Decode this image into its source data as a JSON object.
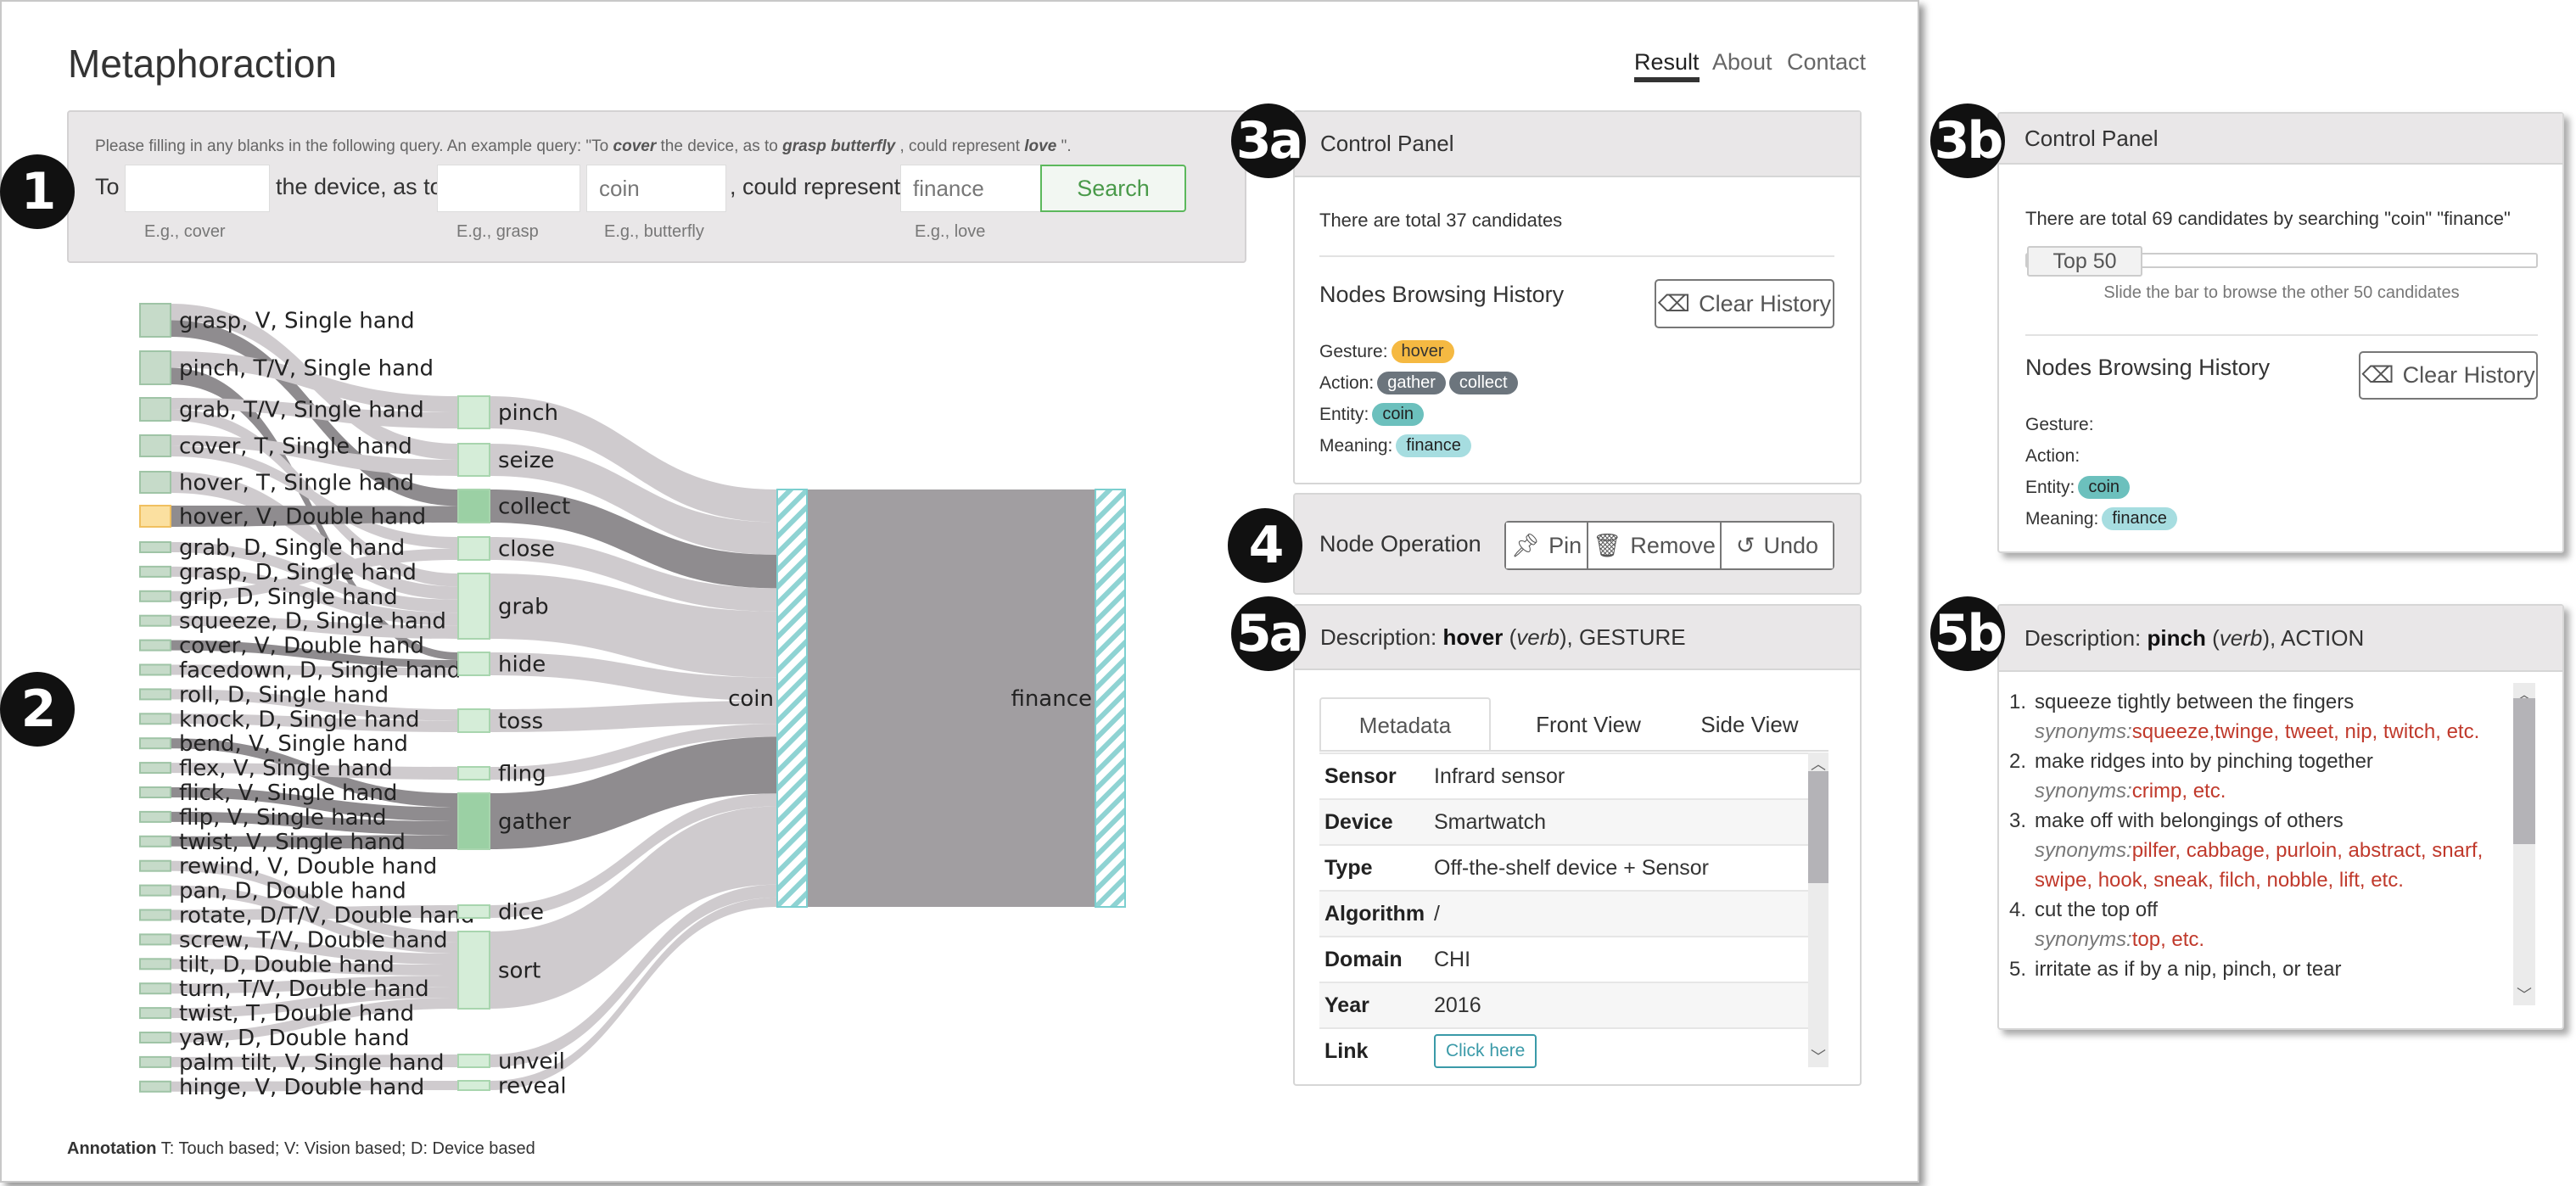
{
  "app": {
    "title": "Metaphoraction",
    "nav": [
      "Result",
      "About",
      "Contact"
    ],
    "active_nav": "Result"
  },
  "badges": {
    "query": "1",
    "sankey": "2",
    "control_a": "3a",
    "control_b": "3b",
    "node_op": "4",
    "desc_a": "5a",
    "desc_b": "5b"
  },
  "query": {
    "hint": [
      {
        "t": "Please filling in any blanks in the following query. An example query: \"To ",
        "i": false
      },
      {
        "t": "cover",
        "i": true
      },
      {
        "t": " the device, as to ",
        "i": false
      },
      {
        "t": "grasp butterfly",
        "i": true
      },
      {
        "t": " , could represent ",
        "i": false
      },
      {
        "t": "love",
        "i": true
      },
      {
        "t": " \".",
        "i": false
      }
    ],
    "to": "To",
    "the_device": "the device, as to",
    "could_represent": ", could represent",
    "gesture": {
      "value": "",
      "hint": "E.g., cover"
    },
    "action": {
      "value": "",
      "hint": "E.g., grasp"
    },
    "entity": {
      "value": "coin",
      "hint": "E.g., butterfly"
    },
    "meaning": {
      "value": "finance",
      "hint": "E.g., love"
    },
    "search_label": "Search"
  },
  "sankey": {
    "left_nodes": [
      "grasp, V, Single hand",
      "pinch, T/V, Single hand",
      "grab, T/V, Single hand",
      "cover, T, Single hand",
      "hover, T, Single hand",
      "hover, V, Double hand",
      "grab, D, Single hand",
      "grasp, D, Single hand",
      "grip, D, Single hand",
      "squeeze, D, Single hand",
      "cover, V, Double hand",
      "facedown, D, Single hand",
      "roll, D, Single hand",
      "knock, D, Single hand",
      "bend, V, Single hand",
      "flex, V, Single hand",
      "flick, V, Single hand",
      "flip, V, Single hand",
      "twist, V, Single hand",
      "rewind, V, Double hand",
      "pan, D, Double hand",
      "rotate, D/T/V, Double hand",
      "screw, T/V, Double hand",
      "tilt, D, Double hand",
      "turn, T/V, Double hand",
      "twist, T, Double hand",
      "yaw, D, Double hand",
      "palm tilt, V, Single hand",
      "hinge, V, Double hand"
    ],
    "selected_gesture": "hover, V, Double hand",
    "mid_nodes": [
      "pinch",
      "seize",
      "collect",
      "close",
      "grab",
      "hide",
      "toss",
      "fling",
      "gather",
      "dice",
      "sort",
      "unveil",
      "reveal"
    ],
    "highlighted_actions": [
      "collect",
      "gather"
    ],
    "entity": "coin",
    "meaning": "finance",
    "links": [
      [
        0,
        1,
        false
      ],
      [
        0,
        2,
        true
      ],
      [
        1,
        0,
        false
      ],
      [
        1,
        5,
        true
      ],
      [
        2,
        0,
        false
      ],
      [
        2,
        4,
        false
      ],
      [
        3,
        1,
        false
      ],
      [
        3,
        3,
        false
      ],
      [
        4,
        4,
        false
      ],
      [
        5,
        2,
        true
      ],
      [
        6,
        4,
        false
      ],
      [
        7,
        4,
        false
      ],
      [
        8,
        3,
        false
      ],
      [
        9,
        4,
        false
      ],
      [
        10,
        5,
        true
      ],
      [
        11,
        5,
        false
      ],
      [
        12,
        6,
        false
      ],
      [
        13,
        6,
        false
      ],
      [
        14,
        8,
        true
      ],
      [
        15,
        7,
        false
      ],
      [
        16,
        8,
        true
      ],
      [
        17,
        8,
        true
      ],
      [
        18,
        8,
        true
      ],
      [
        19,
        10,
        false
      ],
      [
        20,
        10,
        false
      ],
      [
        21,
        9,
        false
      ],
      [
        22,
        10,
        false
      ],
      [
        23,
        10,
        false
      ],
      [
        24,
        10,
        false
      ],
      [
        25,
        10,
        false
      ],
      [
        26,
        10,
        false
      ],
      [
        27,
        11,
        false
      ],
      [
        28,
        12,
        false
      ]
    ],
    "colors": {
      "link": "#cfcbce",
      "link_highlight": "#8f8c8f",
      "gesture_node": "#c6dbc9",
      "selected_node": "#fbe0a0",
      "action_node": "#d5edd8",
      "action_highlight": "#9bd0a4",
      "entity_hatch": "#8fd3d3",
      "flow": "#a19ea1"
    }
  },
  "annotation": {
    "label": "Annotation",
    "text": "T: Touch based; V: Vision based; D: Device based"
  },
  "control_a": {
    "title": "Control Panel",
    "total": "There are total 37 candidates",
    "history_title": "Nodes Browsing History",
    "clear_label": "Clear History",
    "rows": [
      {
        "label": "Gesture:",
        "pills": [
          "hover"
        ],
        "kind": "g"
      },
      {
        "label": "Action:",
        "pills": [
          "gather",
          "collect"
        ],
        "kind": "a"
      },
      {
        "label": "Entity:",
        "pills": [
          "coin"
        ],
        "kind": "e"
      },
      {
        "label": "Meaning:",
        "pills": [
          "finance"
        ],
        "kind": "m"
      }
    ]
  },
  "node_op": {
    "title": "Node Operation",
    "pin": "Pin",
    "remove": "Remove",
    "undo": "Undo"
  },
  "desc_a": {
    "prefix": "Description:",
    "word": "hover",
    "pos": "verb",
    "category": "GESTURE",
    "tabs": [
      "Metadata",
      "Front View",
      "Side View"
    ],
    "active_tab": "Metadata",
    "rows": [
      [
        "Sensor",
        "Infrard sensor"
      ],
      [
        "Device",
        "Smartwatch"
      ],
      [
        "Type",
        "Off-the-shelf device + Sensor"
      ],
      [
        "Algorithm",
        "/"
      ],
      [
        "Domain",
        "CHI"
      ],
      [
        "Year",
        "2016"
      ]
    ],
    "link_label": "Link",
    "link_button": "Click here"
  },
  "control_b": {
    "title": "Control Panel",
    "total": "There are total 69 candidates by searching \"coin\" \"finance\"",
    "slider_label": "Top 50",
    "slider_value": 50,
    "slider_max": 69,
    "slider_hint": "Slide the bar to browse the other 50 candidates",
    "history_title": "Nodes Browsing History",
    "clear_label": "Clear History",
    "rows": [
      {
        "label": "Gesture:",
        "pills": [],
        "kind": "g"
      },
      {
        "label": "Action:",
        "pills": [],
        "kind": "a"
      },
      {
        "label": "Entity:",
        "pills": [
          "coin"
        ],
        "kind": "e"
      },
      {
        "label": "Meaning:",
        "pills": [
          "finance"
        ],
        "kind": "m"
      }
    ]
  },
  "desc_b": {
    "prefix": "Description:",
    "word": "pinch",
    "pos": "verb",
    "category": "ACTION",
    "synonyms_label": "synonyms:",
    "senses": [
      {
        "def": "squeeze tightly between the fingers",
        "syn": "squeeze,twinge, tweet, nip, twitch, etc."
      },
      {
        "def": "make ridges into by pinching together",
        "syn": "crimp, etc."
      },
      {
        "def": "make off with belongings of others",
        "syn": "pilfer, cabbage, purloin, abstract, snarf, swipe, hook, sneak, filch, nobble, lift, etc."
      },
      {
        "def": "cut the top off",
        "syn": "top, etc."
      },
      {
        "def": "irritate as if by a nip, pinch, or tear",
        "syn": ""
      }
    ]
  }
}
